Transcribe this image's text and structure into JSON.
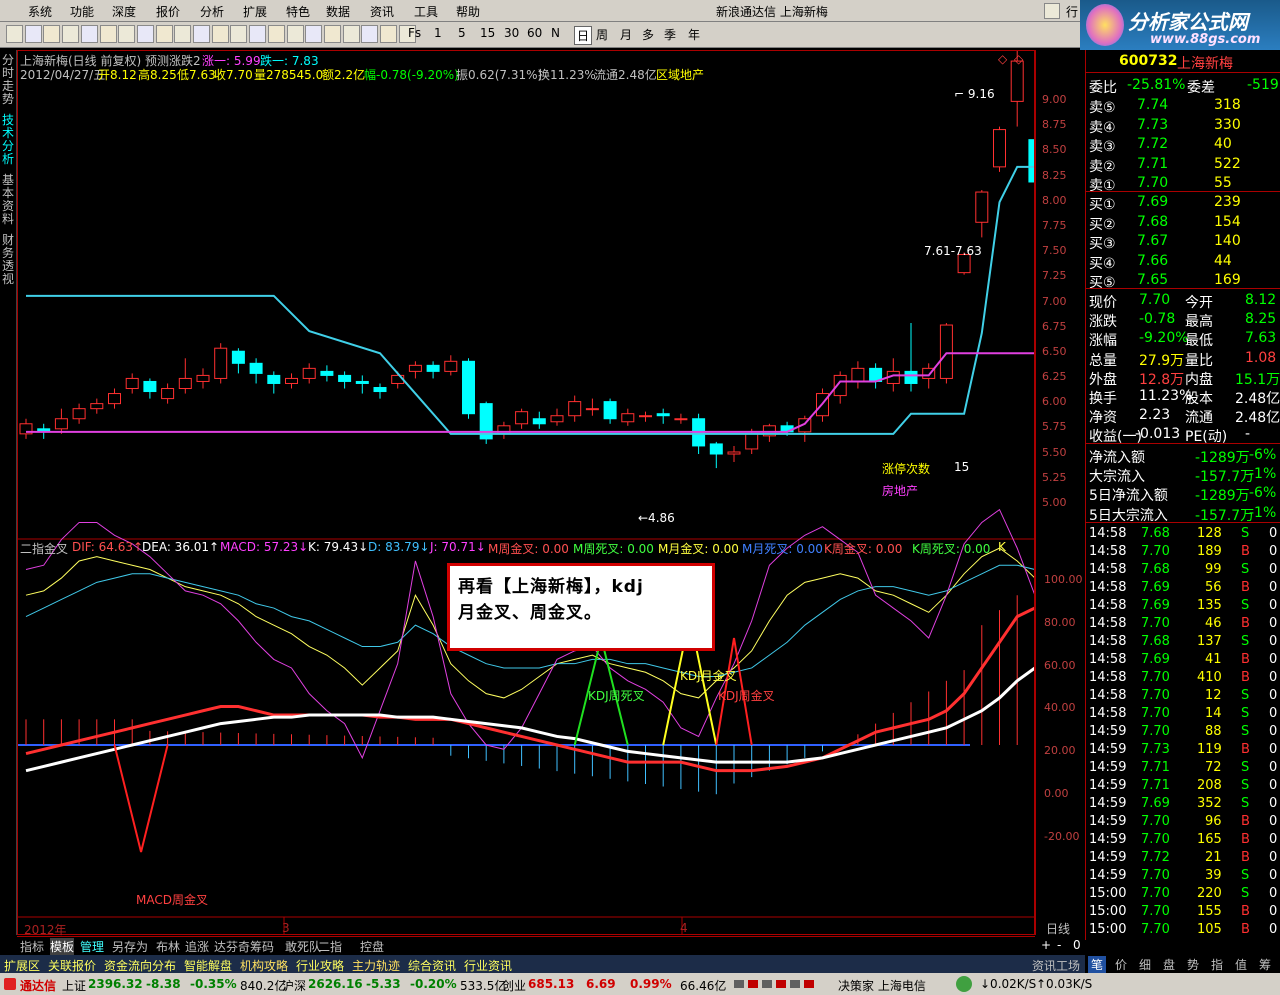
{
  "menu": {
    "items": [
      "系统",
      "功能",
      "深度",
      "报价",
      "分析",
      "扩展",
      "特色",
      "数据",
      "资讯",
      "工具",
      "帮助"
    ],
    "app_title": "新浪通达信  上海新梅",
    "extra": "行"
  },
  "toolbar": {
    "buttons": [
      "Fs",
      "1",
      "5",
      "15",
      "30",
      "60",
      "N",
      "日",
      "周",
      "月",
      "多",
      "季",
      "年"
    ]
  },
  "logo": {
    "text": "分析家公式网",
    "url": "www.88gs.com"
  },
  "vtabs": [
    "分时走势",
    "技术分析",
    "基本资料",
    "财务透视"
  ],
  "header": {
    "line1": {
      "name": "上海新梅(日线 前复权) 预测涨跌2",
      "zhang": "涨一: 5.99",
      "die": "跌一: 7.83"
    },
    "line2": {
      "date": "2012/04/27/五",
      "open": "开8.12",
      "high": "高8.25",
      "low": "低7.63",
      "close": "收7.70",
      "vol": "量278545.0",
      "amt": "额2.2亿",
      "pct": "幅-0.78(-9.20%)",
      "amp": "振0.62(7.31%)",
      "turn": "换11.23%",
      "flow": "流通2.48亿",
      "sector": "区域地产"
    }
  },
  "price_axis": [
    "9.00",
    "8.75",
    "8.50",
    "8.25",
    "8.00",
    "7.75",
    "7.50",
    "7.25",
    "7.00",
    "6.75",
    "6.50",
    "6.25",
    "6.00",
    "5.75",
    "5.50",
    "5.25",
    "5.00"
  ],
  "annotations": {
    "high": "9.16",
    "low": "4.86",
    "range": "7.61-7.63",
    "zt_label": "涨停次数",
    "zt_count": "15",
    "sector_label": "房地产"
  },
  "indicator": {
    "name": "二指金叉",
    "values": [
      {
        "t": "DIF: 64.63↑",
        "c": "#ff5050"
      },
      {
        "t": "DEA: 36.01↑",
        "c": "#ffffff"
      },
      {
        "t": "MACD: 57.23↓",
        "c": "#ff40ff"
      },
      {
        "t": "K: 79.43↓",
        "c": "#ffffff"
      },
      {
        "t": "D: 83.79↓",
        "c": "#40c0ff"
      },
      {
        "t": "J: 70.71↓",
        "c": "#ff40ff"
      },
      {
        "t": "M周金叉: 0.00",
        "c": "#ff5050"
      },
      {
        "t": "M周死叉: 0.00",
        "c": "#40ff40"
      },
      {
        "t": "M月金叉: 0.00",
        "c": "#ffff40"
      },
      {
        "t": "M月死叉: 0.00",
        "c": "#4080ff"
      },
      {
        "t": "K周金叉: 0.00",
        "c": "#ff5050"
      },
      {
        "t": "K周死叉: 0.00",
        "c": "#40ff40"
      },
      {
        "t": "K",
        "c": "#ffff40"
      }
    ],
    "axis": [
      "100.00",
      "80.00",
      "60.00",
      "40.00",
      "20.00",
      "0.00",
      "-20.00"
    ],
    "labels": {
      "macd": "MACD周金叉",
      "kdj_dead": "KDJ周死叉",
      "kdj_month": "KDJ月金叉",
      "kdj_week": "KDJ周金叉"
    }
  },
  "note": {
    "line1": "再看【上海新梅】，kdj",
    "line2": "月金叉、周金叉。"
  },
  "timeline": {
    "year": "2012年",
    "m3": "3",
    "m4": "4",
    "period": "日线"
  },
  "tabs": [
    "指标",
    "模板",
    "管理",
    "另存为",
    "布林",
    "追涨",
    "达芬奇",
    "筹码",
    "敢死队",
    "二指",
    "控盘"
  ],
  "tab_controls": [
    "+",
    "-",
    "0"
  ],
  "quote": {
    "code": "600732",
    "name": "上海新梅",
    "wb": {
      "l1": "委比",
      "v1": "-25.81%",
      "l2": "委差",
      "v2": "-519"
    },
    "asks": [
      {
        "l": "卖⑤",
        "p": "7.74",
        "v": "318"
      },
      {
        "l": "卖④",
        "p": "7.73",
        "v": "330"
      },
      {
        "l": "卖③",
        "p": "7.72",
        "v": "40"
      },
      {
        "l": "卖②",
        "p": "7.71",
        "v": "522"
      },
      {
        "l": "卖①",
        "p": "7.70",
        "v": "55"
      }
    ],
    "bids": [
      {
        "l": "买①",
        "p": "7.69",
        "v": "239"
      },
      {
        "l": "买②",
        "p": "7.68",
        "v": "154"
      },
      {
        "l": "买③",
        "p": "7.67",
        "v": "140"
      },
      {
        "l": "买④",
        "p": "7.66",
        "v": "44"
      },
      {
        "l": "买⑤",
        "p": "7.65",
        "v": "169"
      }
    ],
    "stats": [
      {
        "l1": "现价",
        "v1": "7.70",
        "c1": "#00ff00",
        "l2": "今开",
        "v2": "8.12",
        "c2": "#00ff00"
      },
      {
        "l1": "涨跌",
        "v1": "-0.78",
        "c1": "#00ff00",
        "l2": "最高",
        "v2": "8.25",
        "c2": "#00ff00"
      },
      {
        "l1": "涨幅",
        "v1": "-9.20%",
        "c1": "#00ff00",
        "l2": "最低",
        "v2": "7.63",
        "c2": "#00ff00"
      },
      {
        "l1": "总量",
        "v1": "27.9万",
        "c1": "#ffff00",
        "l2": "量比",
        "v2": "1.08",
        "c2": "#ff4040"
      },
      {
        "l1": "外盘",
        "v1": "12.8万",
        "c1": "#ff4040",
        "l2": "内盘",
        "v2": "15.1万",
        "c2": "#00ff00"
      },
      {
        "l1": "换手",
        "v1": "11.23%",
        "c1": "#ffffff",
        "l2": "股本",
        "v2": "2.48亿",
        "c2": "#ffffff"
      },
      {
        "l1": "净资",
        "v1": "2.23",
        "c1": "#ffffff",
        "l2": "流通",
        "v2": "2.48亿",
        "c2": "#ffffff"
      },
      {
        "l1": "收益(一)",
        "v1": "-0.013",
        "c1": "#ffffff",
        "l2": "PE(动)",
        "v2": "-",
        "c2": "#ffffff"
      }
    ],
    "flows": [
      {
        "l": "净流入额",
        "v": "-1289万",
        "p": "-6%"
      },
      {
        "l": "大宗流入",
        "v": "-157.7万",
        "p": "-1%"
      },
      {
        "l": "5日净流入额",
        "v": "-1289万",
        "p": "-6%"
      },
      {
        "l": "5日大宗流入",
        "v": "-157.7万",
        "p": "-1%"
      }
    ],
    "ticks": [
      [
        "14:58",
        "7.68",
        "128",
        "S",
        "0"
      ],
      [
        "14:58",
        "7.70",
        "189",
        "B",
        "0"
      ],
      [
        "14:58",
        "7.68",
        "99",
        "S",
        "0"
      ],
      [
        "14:58",
        "7.69",
        "56",
        "B",
        "0"
      ],
      [
        "14:58",
        "7.69",
        "135",
        "S",
        "0"
      ],
      [
        "14:58",
        "7.70",
        "46",
        "B",
        "0"
      ],
      [
        "14:58",
        "7.68",
        "137",
        "S",
        "0"
      ],
      [
        "14:58",
        "7.69",
        "41",
        "B",
        "0"
      ],
      [
        "14:58",
        "7.70",
        "410",
        "B",
        "0"
      ],
      [
        "14:58",
        "7.70",
        "12",
        "S",
        "0"
      ],
      [
        "14:58",
        "7.70",
        "14",
        "S",
        "0"
      ],
      [
        "14:59",
        "7.70",
        "88",
        "S",
        "0"
      ],
      [
        "14:59",
        "7.73",
        "119",
        "B",
        "0"
      ],
      [
        "14:59",
        "7.71",
        "72",
        "S",
        "0"
      ],
      [
        "14:59",
        "7.71",
        "208",
        "S",
        "0"
      ],
      [
        "14:59",
        "7.69",
        "352",
        "S",
        "0"
      ],
      [
        "14:59",
        "7.70",
        "96",
        "B",
        "0"
      ],
      [
        "14:59",
        "7.70",
        "165",
        "B",
        "0"
      ],
      [
        "14:59",
        "7.72",
        "21",
        "B",
        "0"
      ],
      [
        "14:59",
        "7.70",
        "39",
        "S",
        "0"
      ],
      [
        "15:00",
        "7.70",
        "220",
        "S",
        "0"
      ],
      [
        "15:00",
        "7.70",
        "155",
        "B",
        "0"
      ],
      [
        "15:00",
        "7.70",
        "105",
        "B",
        "0"
      ]
    ],
    "bottom_tabs": [
      "笔",
      "价",
      "细",
      "盘",
      "势",
      "指",
      "值",
      "筹"
    ]
  },
  "status1": [
    "扩展区",
    "关联报价",
    "资金流向分布",
    "智能解盘",
    "机构攻略",
    "行业攻略",
    "主力轨迹",
    "综合资讯",
    "行业资讯"
  ],
  "status1_right": "资讯工场",
  "status2": {
    "brand": "通达信",
    "sh": {
      "n": "上证",
      "v": "2396.32",
      "c": "-8.38",
      "p": "-0.35%",
      "a": "840.2亿"
    },
    "sz": {
      "n": "沪深",
      "v": "2626.16",
      "c": "-5.33",
      "p": "-0.20%",
      "a": "533.5亿"
    },
    "cy": {
      "n": "创业",
      "v": "685.13",
      "c": "6.69",
      "p": "0.99%",
      "a": "66.46亿"
    },
    "right": "决策家 上海电信",
    "net": {
      "down": "0.02K/S",
      "up": "0.03K/S"
    }
  },
  "chart_data": {
    "type": "candlestick",
    "price_range": [
      4.8,
      9.3
    ],
    "candles": [
      [
        5.2,
        5.3,
        5.15,
        5.35
      ],
      [
        5.25,
        5.22,
        5.15,
        5.3
      ],
      [
        5.25,
        5.35,
        5.2,
        5.45
      ],
      [
        5.35,
        5.45,
        5.3,
        5.5
      ],
      [
        5.45,
        5.5,
        5.4,
        5.55
      ],
      [
        5.5,
        5.6,
        5.45,
        5.65
      ],
      [
        5.65,
        5.75,
        5.6,
        5.8
      ],
      [
        5.72,
        5.62,
        5.55,
        5.75
      ],
      [
        5.55,
        5.65,
        5.5,
        5.7
      ],
      [
        5.65,
        5.75,
        5.6,
        5.95
      ],
      [
        5.72,
        5.78,
        5.65,
        5.85
      ],
      [
        5.75,
        6.05,
        5.7,
        6.1
      ],
      [
        6.02,
        5.9,
        5.8,
        6.05
      ],
      [
        5.9,
        5.8,
        5.7,
        5.95
      ],
      [
        5.78,
        5.7,
        5.6,
        5.82
      ],
      [
        5.7,
        5.75,
        5.65,
        5.8
      ],
      [
        5.75,
        5.85,
        5.7,
        5.9
      ],
      [
        5.82,
        5.78,
        5.72,
        5.88
      ],
      [
        5.78,
        5.72,
        5.65,
        5.82
      ],
      [
        5.72,
        5.7,
        5.6,
        5.78
      ],
      [
        5.66,
        5.62,
        5.55,
        5.7
      ],
      [
        5.7,
        5.78,
        5.65,
        5.82
      ],
      [
        5.82,
        5.88,
        5.75,
        5.92
      ],
      [
        5.88,
        5.82,
        5.75,
        5.92
      ],
      [
        5.82,
        5.92,
        5.78,
        5.98
      ],
      [
        5.92,
        5.4,
        5.35,
        5.95
      ],
      [
        5.5,
        5.15,
        5.1,
        5.52
      ],
      [
        5.2,
        5.28,
        5.15,
        5.32
      ],
      [
        5.3,
        5.42,
        5.25,
        5.45
      ],
      [
        5.35,
        5.3,
        5.25,
        5.42
      ],
      [
        5.32,
        5.38,
        5.28,
        5.45
      ],
      [
        5.38,
        5.52,
        5.32,
        5.58
      ],
      [
        5.45,
        5.45,
        5.38,
        5.55
      ],
      [
        5.52,
        5.35,
        5.3,
        5.55
      ],
      [
        5.32,
        5.4,
        5.28,
        5.45
      ],
      [
        5.38,
        5.38,
        5.32,
        5.42
      ],
      [
        5.4,
        5.38,
        5.3,
        5.45
      ],
      [
        5.35,
        5.35,
        5.3,
        5.4
      ],
      [
        5.35,
        5.08,
        5.0,
        5.4
      ],
      [
        5.1,
        5.0,
        4.86,
        5.12
      ],
      [
        5.0,
        5.02,
        4.92,
        5.08
      ],
      [
        5.05,
        5.2,
        5.0,
        5.25
      ],
      [
        5.18,
        5.28,
        5.12,
        5.3
      ],
      [
        5.28,
        5.22,
        5.18,
        5.32
      ],
      [
        5.22,
        5.35,
        5.12,
        5.38
      ],
      [
        5.38,
        5.6,
        5.32,
        5.65
      ],
      [
        5.58,
        5.78,
        5.5,
        5.82
      ],
      [
        5.72,
        5.85,
        5.65,
        5.92
      ],
      [
        5.85,
        5.72,
        5.65,
        5.9
      ],
      [
        5.7,
        5.82,
        5.62,
        5.95
      ],
      [
        5.82,
        5.7,
        5.62,
        6.3
      ],
      [
        5.75,
        5.85,
        5.65,
        5.9
      ],
      [
        5.75,
        6.28,
        5.7,
        6.3
      ],
      [
        6.8,
        6.98,
        6.78,
        7.0
      ],
      [
        7.3,
        7.6,
        7.15,
        7.62
      ],
      [
        7.85,
        8.22,
        7.8,
        8.25
      ],
      [
        8.5,
        8.9,
        8.25,
        9.16
      ],
      [
        8.12,
        7.7,
        7.63,
        8.25
      ]
    ],
    "line_cyan": [
      [
        0,
        6.57
      ],
      [
        14,
        6.57
      ],
      [
        16,
        6.22
      ],
      [
        20,
        6.0
      ],
      [
        22,
        5.6
      ],
      [
        24,
        5.2
      ],
      [
        37,
        5.2
      ],
      [
        43,
        5.2
      ],
      [
        47,
        5.2
      ],
      [
        49,
        5.2
      ],
      [
        50,
        5.4
      ],
      [
        53,
        5.4
      ],
      [
        54,
        6.2
      ],
      [
        55,
        7.5
      ],
      [
        56,
        7.85
      ],
      [
        57,
        7.85
      ]
    ],
    "line_magenta": [
      [
        0,
        5.22
      ],
      [
        24,
        5.22
      ],
      [
        43,
        5.22
      ],
      [
        44,
        5.3
      ],
      [
        45,
        5.5
      ],
      [
        46,
        5.72
      ],
      [
        48,
        5.72
      ],
      [
        49,
        5.78
      ],
      [
        50,
        5.78
      ],
      [
        51,
        5.78
      ],
      [
        52,
        6.0
      ],
      [
        57,
        6.0
      ]
    ]
  }
}
